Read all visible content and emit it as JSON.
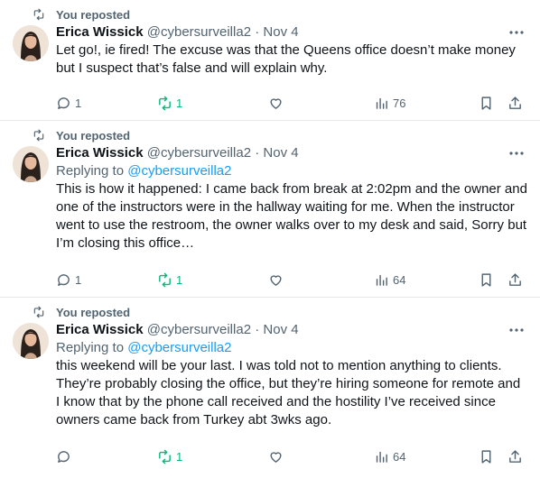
{
  "tweets": [
    {
      "repost_label": "You reposted",
      "author": "Erica Wissick",
      "handle": "@cybersurveilla2",
      "separator": "·",
      "date": "Nov 4",
      "replying_prefix": "",
      "replying_to": "",
      "text": "Let go!, ie fired! The excuse was that the Queens office doesn’t make money but I suspect that’s false and will explain why.",
      "replies": "1",
      "reposts": "1",
      "likes": "",
      "views": "76"
    },
    {
      "repost_label": "You reposted",
      "author": "Erica Wissick",
      "handle": "@cybersurveilla2",
      "separator": "·",
      "date": "Nov 4",
      "replying_prefix": "Replying to",
      "replying_to": "@cybersurveilla2",
      "text": "This is how it happened: I came back from break at 2:02pm and the owner and one of the instructors were in the hallway waiting for me. When the instructor went to use the restroom, the owner walks over to my desk and said, Sorry but I’m closing this office…",
      "replies": "1",
      "reposts": "1",
      "likes": "",
      "views": "64"
    },
    {
      "repost_label": "You reposted",
      "author": "Erica Wissick",
      "handle": "@cybersurveilla2",
      "separator": "·",
      "date": "Nov 4",
      "replying_prefix": "Replying to",
      "replying_to": "@cybersurveilla2",
      "text": "this weekend will be your last. I was told not to mention anything to clients. They’re probably closing the office, but they’re hiring someone for remote and I know that by the phone call received and the hostility I’ve received since owners came back from Turkey abt 3wks ago.",
      "replies": "",
      "reposts": "1",
      "likes": "",
      "views": "64"
    }
  ],
  "colors": {
    "text": "#0f1419",
    "secondary": "#536471",
    "link": "#1d9bf0",
    "repost_active": "#00ba7c",
    "divider": "#e6e9ec"
  },
  "icons": {
    "repost": "repost-icon",
    "reply": "reply-icon",
    "like": "heart-icon",
    "views": "views-icon",
    "bookmark": "bookmark-icon",
    "share": "share-icon",
    "more": "more-icon"
  }
}
